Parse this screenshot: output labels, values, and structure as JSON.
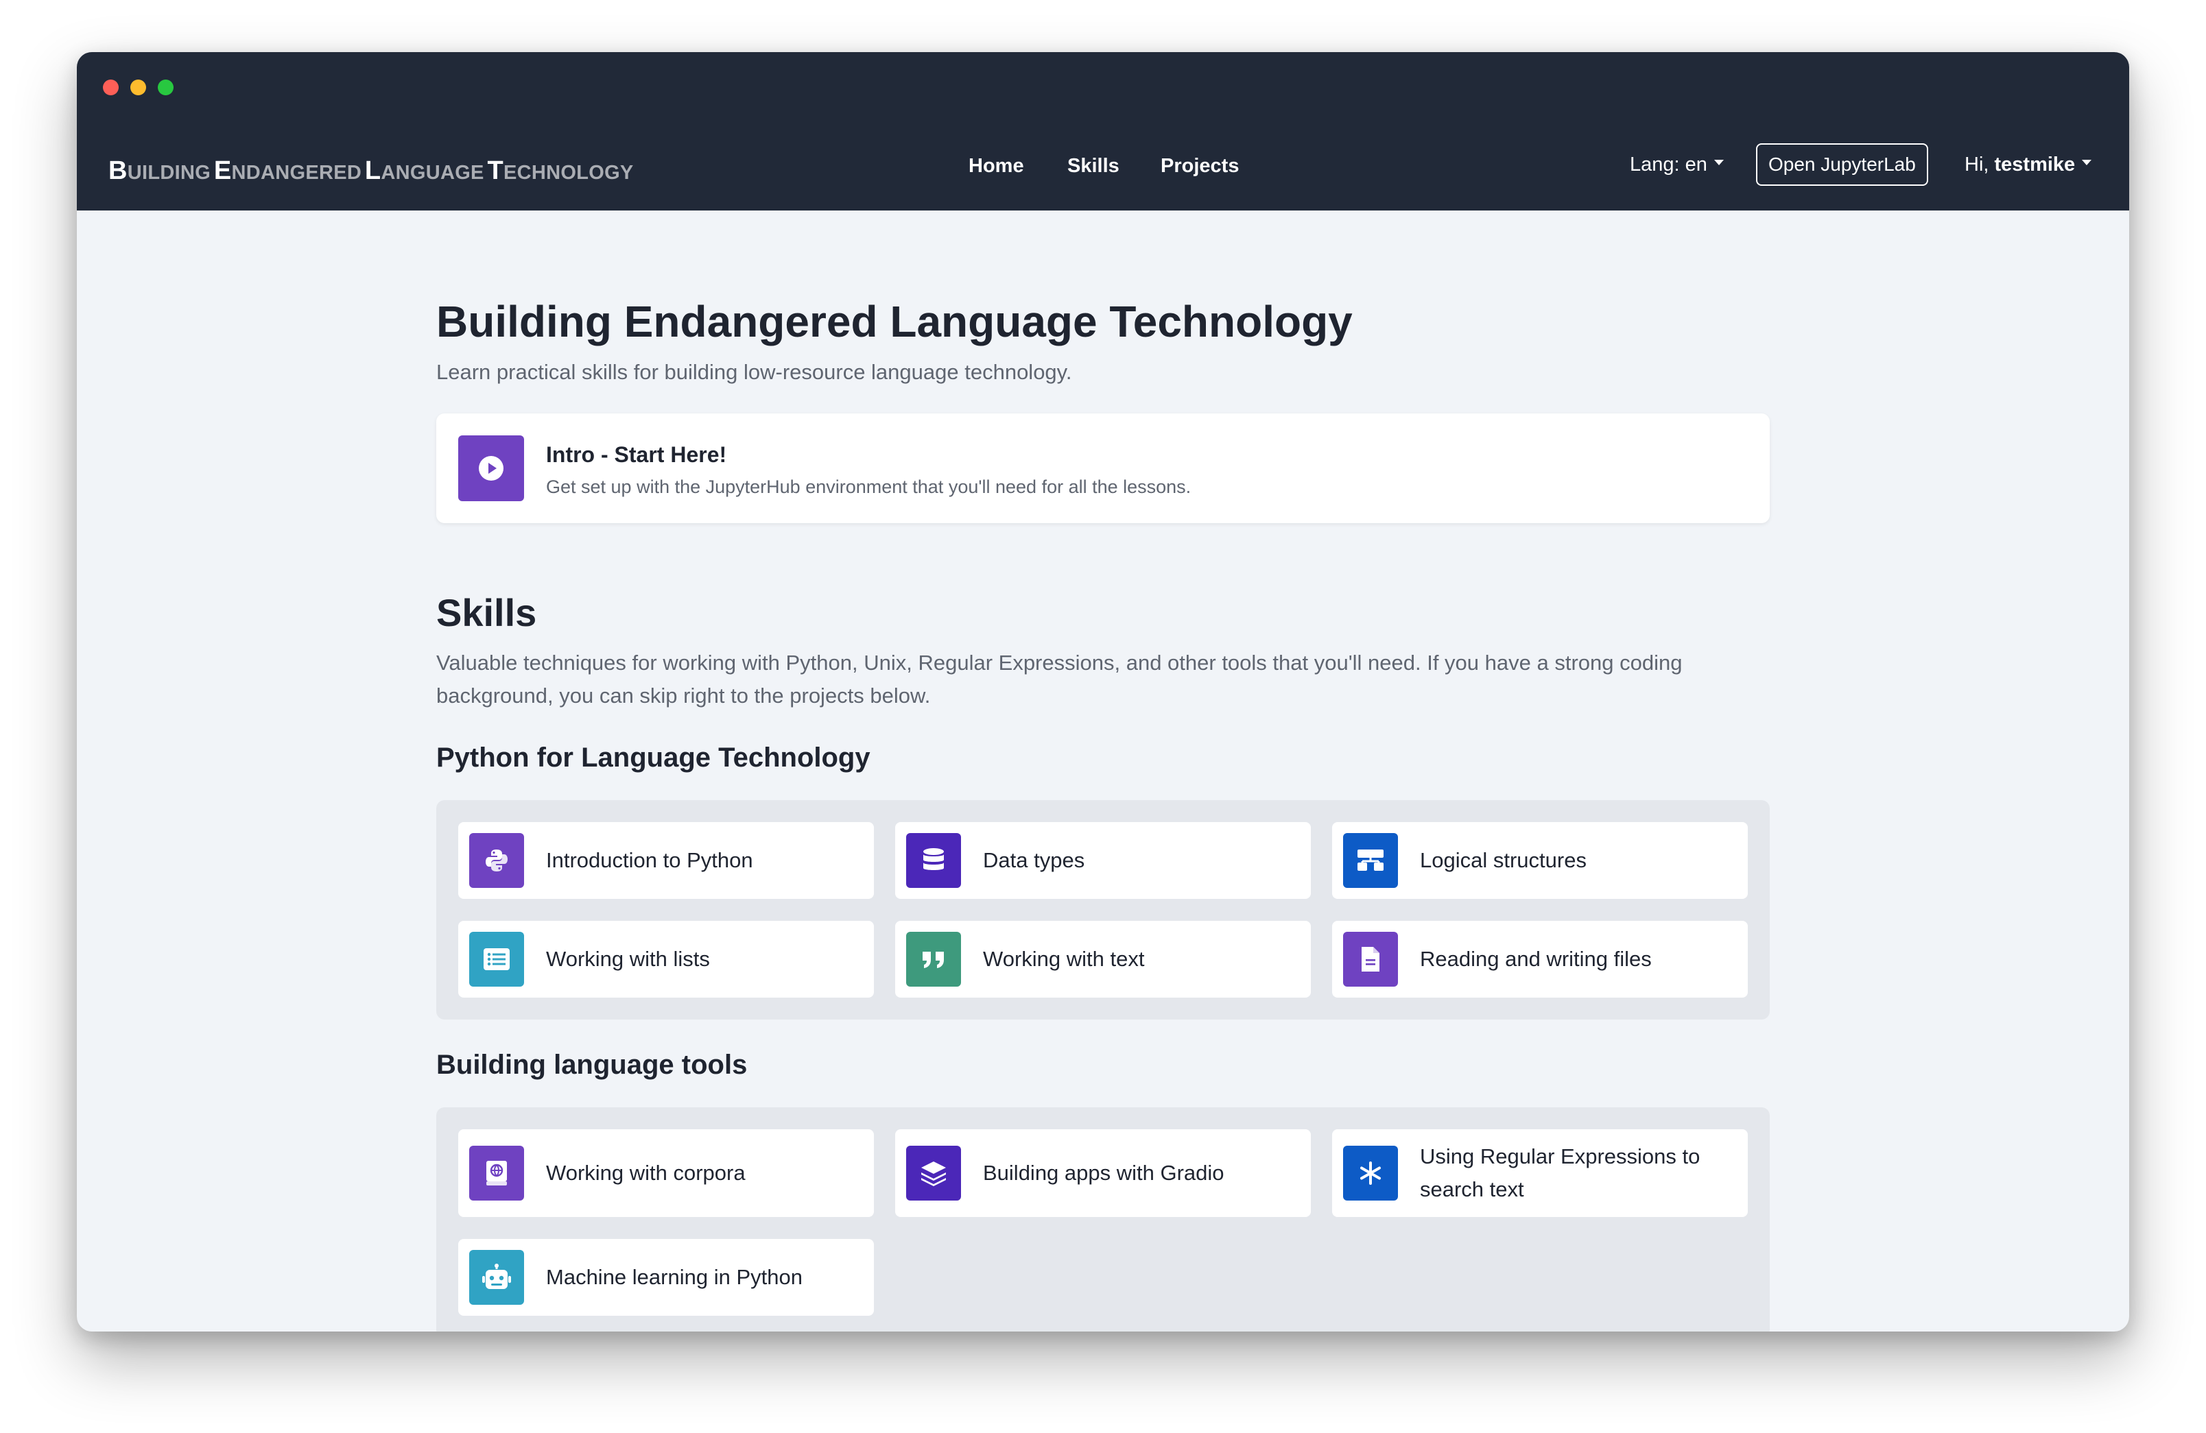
{
  "brand": {
    "words": [
      {
        "cap": "B",
        "rest": "UILDING"
      },
      {
        "cap": "E",
        "rest": "NDANGERED"
      },
      {
        "cap": "L",
        "rest": "ANGUAGE"
      },
      {
        "cap": "T",
        "rest": "ECHNOLOGY"
      }
    ]
  },
  "nav": {
    "home": "Home",
    "skills": "Skills",
    "projects": "Projects",
    "lang": "Lang: en",
    "open_jupyterlab": "Open JupyterLab",
    "greeting": "Hi,",
    "username": "testmike"
  },
  "page": {
    "title": "Building Endangered Language Technology",
    "lead": "Learn practical skills for building low-resource language technology."
  },
  "intro": {
    "title": "Intro - Start Here!",
    "description": "Get set up with the JupyterHub environment that you'll need for all the lessons.",
    "icon": "play-circle-icon",
    "color": "#6f42c1"
  },
  "skills": {
    "heading": "Skills",
    "description": "Valuable techniques for working with Python, Unix, Regular Expressions, and other tools that you'll need. If you have a strong coding background, you can skip right to the projects below.",
    "groups": [
      {
        "title": "Python for Language Technology",
        "items": [
          {
            "label": "Introduction to Python",
            "icon": "python-icon",
            "color": "#6f42c1"
          },
          {
            "label": "Data types",
            "icon": "database-icon",
            "color": "#4b27b8"
          },
          {
            "label": "Logical structures",
            "icon": "flow-icon",
            "color": "#0d5bc6"
          },
          {
            "label": "Working with lists",
            "icon": "list-icon",
            "color": "#30a3c4"
          },
          {
            "label": "Working with text",
            "icon": "quote-icon",
            "color": "#3e9a7d"
          },
          {
            "label": "Reading and writing files",
            "icon": "file-icon",
            "color": "#6f42c1"
          }
        ]
      },
      {
        "title": "Building language tools",
        "items": [
          {
            "label": "Working with corpora",
            "icon": "book-globe-icon",
            "color": "#6f42c1"
          },
          {
            "label": "Building apps with Gradio",
            "icon": "layers-icon",
            "color": "#4b27b8"
          },
          {
            "label": "Using Regular Expressions to search text",
            "icon": "asterisk-icon",
            "color": "#0d5bc6"
          },
          {
            "label": "Machine learning in Python",
            "icon": "robot-icon",
            "color": "#30a3c4"
          }
        ]
      }
    ]
  }
}
